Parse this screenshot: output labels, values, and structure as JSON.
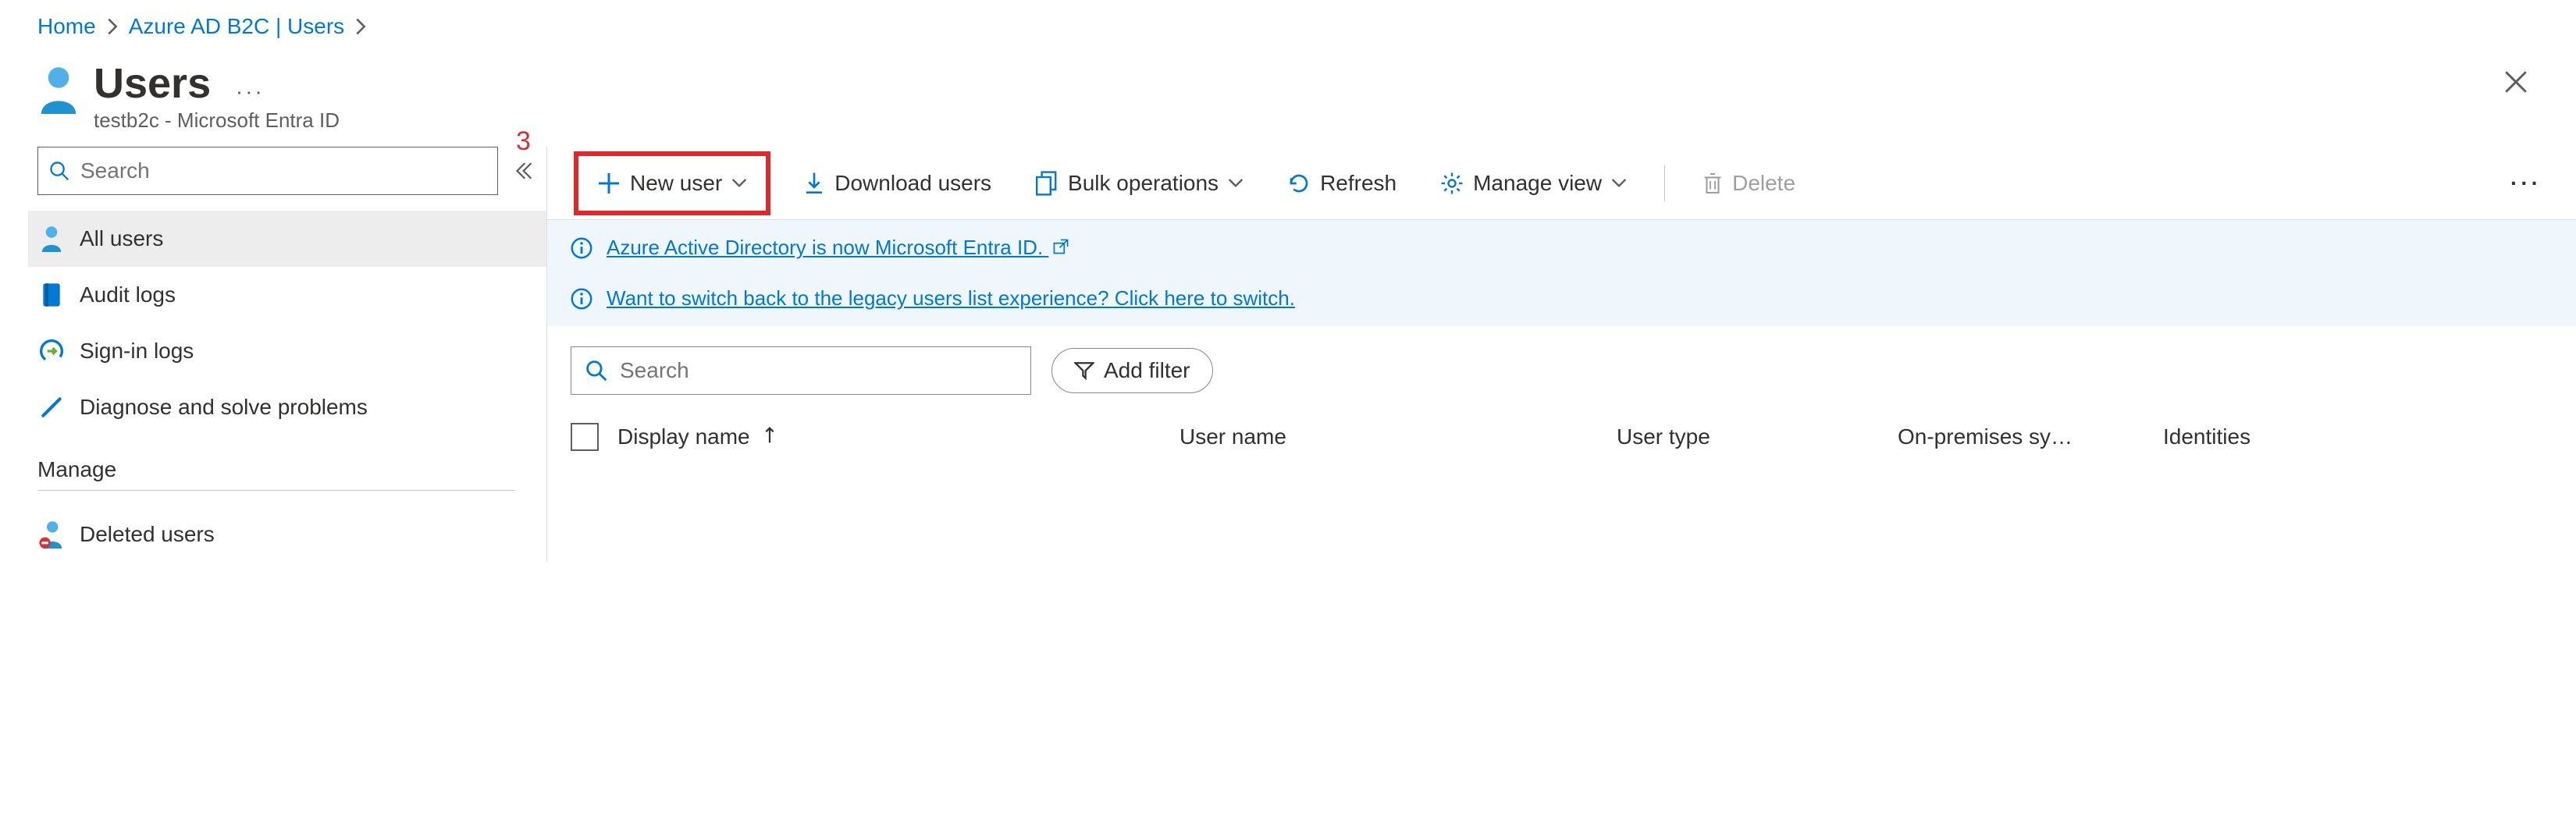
{
  "breadcrumb": {
    "items": [
      "Home",
      "Azure AD B2C | Users"
    ]
  },
  "header": {
    "title": "Users",
    "subtitle": "testb2c - Microsoft Entra ID"
  },
  "sidebar": {
    "search_placeholder": "Search",
    "items": [
      {
        "label": "All users",
        "icon": "user-icon"
      },
      {
        "label": "Audit logs",
        "icon": "book-icon"
      },
      {
        "label": "Sign-in logs",
        "icon": "signin-icon"
      },
      {
        "label": "Diagnose and solve problems",
        "icon": "wrench-icon"
      }
    ],
    "section_manage": "Manage",
    "manage_items": [
      {
        "label": "Deleted users",
        "icon": "deleted-user-icon"
      }
    ]
  },
  "annotation": {
    "marker": "3"
  },
  "toolbar": {
    "new_user": "New user",
    "download_users": "Download users",
    "bulk_ops": "Bulk operations",
    "refresh": "Refresh",
    "manage_view": "Manage view",
    "delete": "Delete"
  },
  "banners": {
    "entra": "Azure Active Directory is now Microsoft Entra ID.",
    "legacy": "Want to switch back to the legacy users list experience? Click here to switch."
  },
  "list": {
    "search_placeholder": "Search",
    "add_filter": "Add filter",
    "columns": {
      "display_name": "Display name",
      "user_name": "User name",
      "user_type": "User type",
      "on_prem": "On-premises sy…",
      "identities": "Identities"
    }
  }
}
